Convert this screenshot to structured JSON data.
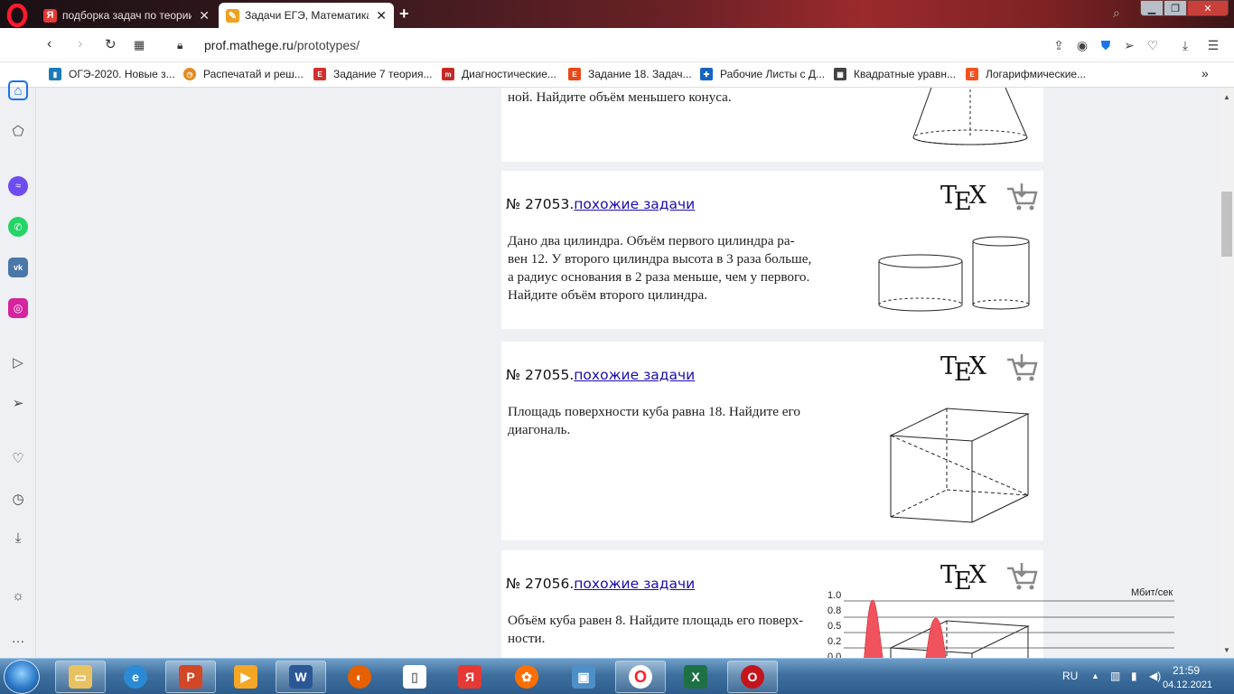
{
  "tabs": [
    {
      "title": "подборка задач по теории",
      "favicon": "yandex-icon",
      "color": "#e53935",
      "active": false
    },
    {
      "title": "Задачи ЕГЭ, Математика, ",
      "favicon": "mathege-icon",
      "color": "#f0a020",
      "active": true
    }
  ],
  "address": {
    "domain": "prof.mathege.ru",
    "path": "/prototypes/"
  },
  "bookmarks": [
    {
      "label": "ОГЭ-2020. Новые з...",
      "icon": "book-icon",
      "color": "#1a7bb9"
    },
    {
      "label": "Распечатай и реш...",
      "icon": "clock-icon",
      "color": "#e58a1f"
    },
    {
      "label": "Задание 7 теория...",
      "icon": "ege-icon",
      "color": "#d32f2f"
    },
    {
      "label": "Диагностические...",
      "icon": "math100-icon",
      "color": "#c62828"
    },
    {
      "label": "Задание 18. Задач...",
      "icon": "ege-icon",
      "color": "#e64a19"
    },
    {
      "label": "Рабочие Листы с Д...",
      "icon": "plus-icon",
      "color": "#1565c0"
    },
    {
      "label": "Квадратные уравн...",
      "icon": "grid-icon",
      "color": "#424242"
    },
    {
      "label": "Логарифмические...",
      "icon": "ege-icon",
      "color": "#f4511e"
    }
  ],
  "problems": [
    {
      "text_tail": "ной. Найдите объём меньшего конуса."
    },
    {
      "number": "№ 27053.",
      "link": "похожие задачи",
      "tex_t": "T",
      "tex_e": "E",
      "tex_x": "X",
      "lines": [
        "Дано два цилиндра. Объём первого цилиндра ра-",
        "вен 12. У второго цилиндра высота в 3 раза больше,",
        "а радиус основания в 2 раза меньше, чем у первого.",
        "Найдите объём второго цилиндра."
      ]
    },
    {
      "number": "№ 27055.",
      "link": "похожие задачи",
      "tex_t": "T",
      "tex_e": "E",
      "tex_x": "X",
      "lines": [
        "Площадь поверхности куба равна 18. Найдите его",
        "диагональ."
      ]
    },
    {
      "number": "№ 27056.",
      "link": "похожие задачи",
      "tex_t": "T",
      "tex_e": "E",
      "tex_x": "X",
      "lines": [
        "Объём куба равен 8. Найдите площадь его поверх-",
        "ности."
      ]
    }
  ],
  "net_gadget": {
    "unit": "Мбит/сек",
    "ticks": [
      "1.0",
      "0.8",
      "0.5",
      "0.2",
      "0.0"
    ]
  },
  "taskbar": {
    "lang": "RU",
    "time": "21:59",
    "date": "04.12.2021"
  }
}
